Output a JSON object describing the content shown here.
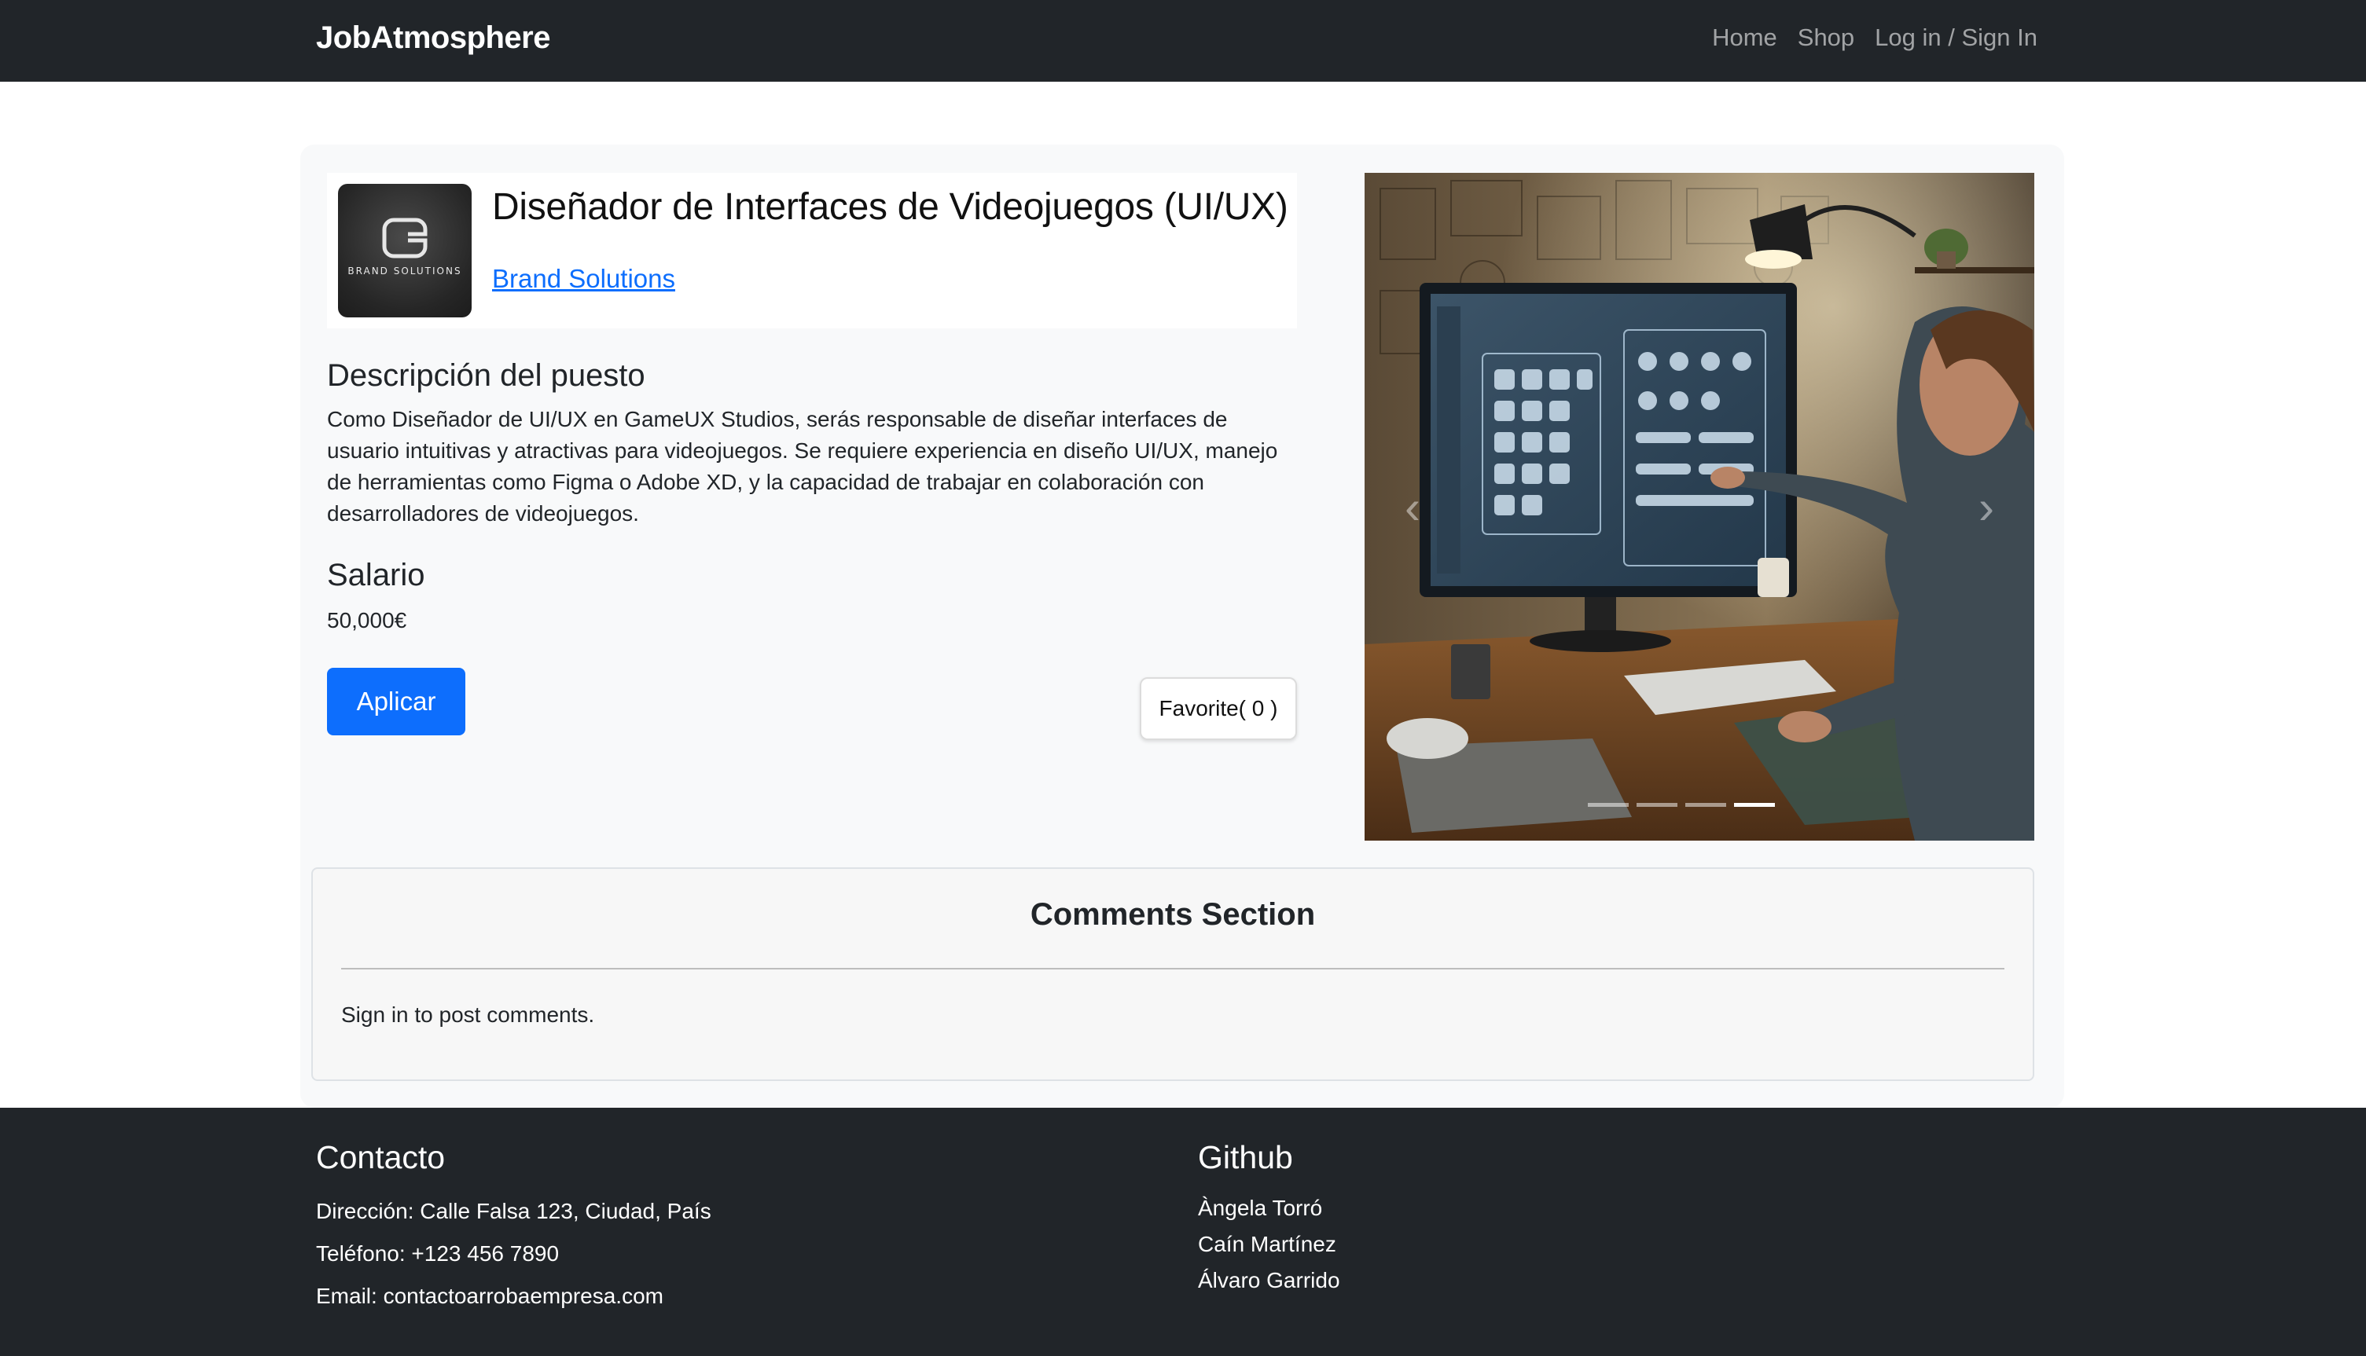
{
  "navbar": {
    "brand": "JobAtmosphere",
    "links": [
      "Home",
      "Shop",
      "Log in / Sign In"
    ]
  },
  "job": {
    "title": "Diseñador de Interfaces de Videojuegos (UI/UX)",
    "company": "Brand Solutions",
    "logo_text": "BRAND SOLUTIONS",
    "description_heading": "Descripción del puesto",
    "description": "Como Diseñador de UI/UX en GameUX Studios, serás responsable de diseñar interfaces de usuario intuitivas y atractivas para videojuegos. Se requiere experiencia en diseño UI/UX, manejo de herramientas como Figma o Adobe XD, y la capacidad de trabajar en colaboración con desarrolladores de videojuegos.",
    "salary_heading": "Salario",
    "salary": "50,000€",
    "apply_label": "Aplicar",
    "favorite_label": "Favorite( 0 )"
  },
  "carousel": {
    "slide_count": 4,
    "active_index": 3,
    "prev_icon": "chevron-left-icon",
    "next_icon": "chevron-right-icon"
  },
  "comments": {
    "title": "Comments Section",
    "note": "Sign in to post comments."
  },
  "footer": {
    "contact_heading": "Contacto",
    "contact_lines": [
      "Dirección: Calle Falsa 123, Ciudad, País",
      "Teléfono: +123 456 7890",
      "Email: contactoarrobaempresa.com"
    ],
    "github_heading": "Github",
    "github_names": [
      "Àngela Torró",
      "Caín Martínez",
      "Álvaro Garrido"
    ]
  },
  "colors": {
    "navbar_bg": "#212529",
    "primary": "#0d6efd",
    "card_bg": "#f8f9fa",
    "footer_bg": "#212529"
  }
}
